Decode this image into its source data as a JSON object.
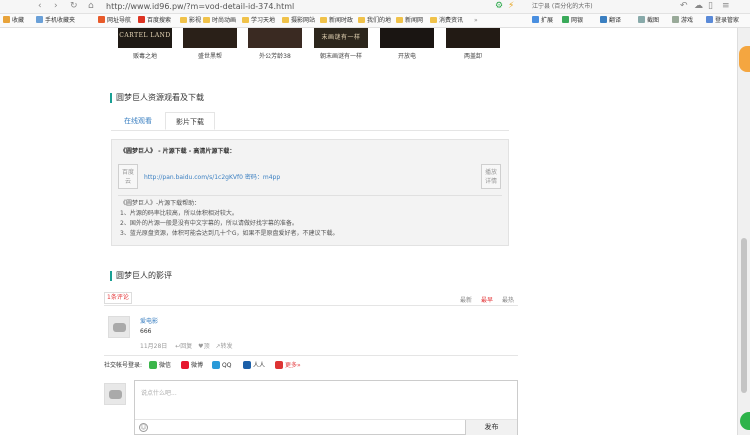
{
  "browser": {
    "url": "http://www.id96.pw/?m=vod-detail-id-374.html",
    "bookmarks": [
      "收藏",
      "手机收藏夹",
      "网址导航",
      "百度搜索",
      "影视",
      "时尚动画",
      "学习天地",
      "摄影网站",
      "新闻时政",
      "我们的地",
      "新闻网",
      "消费资讯"
    ],
    "search_hint": "江宁县 (百分化的大市)",
    "right_tools": [
      "扩展",
      "网银",
      "翻译",
      "截图",
      "游戏",
      "登录管家"
    ]
  },
  "movies": [
    {
      "title": "贩毒之地",
      "art": "CARTEL LAND"
    },
    {
      "title": "盛世黑帮",
      "art": ""
    },
    {
      "title": "外公芳龄38",
      "art": ""
    },
    {
      "title": "朝末画谜有一样",
      "art": "末画谜有一样"
    },
    {
      "title": "开放电",
      "art": ""
    },
    {
      "title": "两盖卸",
      "art": ""
    }
  ],
  "resource_section": {
    "heading": "圆梦巨人资源观看及下载",
    "tabs": [
      "在线观看",
      "影片下载"
    ],
    "active_tab": 1
  },
  "download": {
    "title": "《圆梦巨人》 - 片源下载 - 高清片源下载：",
    "left_button": "百度\n云",
    "link": "http://pan.baidu.com/s/1c2gKVf0 密码：m4pp",
    "right_button": "播放\n详情",
    "help_lines": [
      "《圆梦巨人》-片源下载帮助：",
      "1、片源的码率比较高，所以体积相对较大。",
      "2、国外的片源一般是没有中文字幕的，所以请做好找字幕的准备。",
      "3、蓝光原盘资源，体积可能会达到几十个G，如果不是原盘爱好者，不建议下载。"
    ]
  },
  "comments_section": {
    "heading": "圆梦巨人的影评",
    "count_label": "1条评论",
    "sort": [
      "最新",
      "最早",
      "最热"
    ],
    "comment": {
      "user": "爱电影",
      "text": "666",
      "meta": "11月28日",
      "actions": [
        "回复",
        "顶",
        "转发"
      ]
    },
    "share_prefix": "社交帐号登录:",
    "share": [
      "微信",
      "微博",
      "QQ",
      "人人",
      "更多»"
    ],
    "input_placeholder": "说点什么吧...",
    "post_button": "发布"
  },
  "colors": {
    "accent": "#1aa094",
    "link": "#3a7fc1",
    "sort_active": "#e4393c"
  }
}
